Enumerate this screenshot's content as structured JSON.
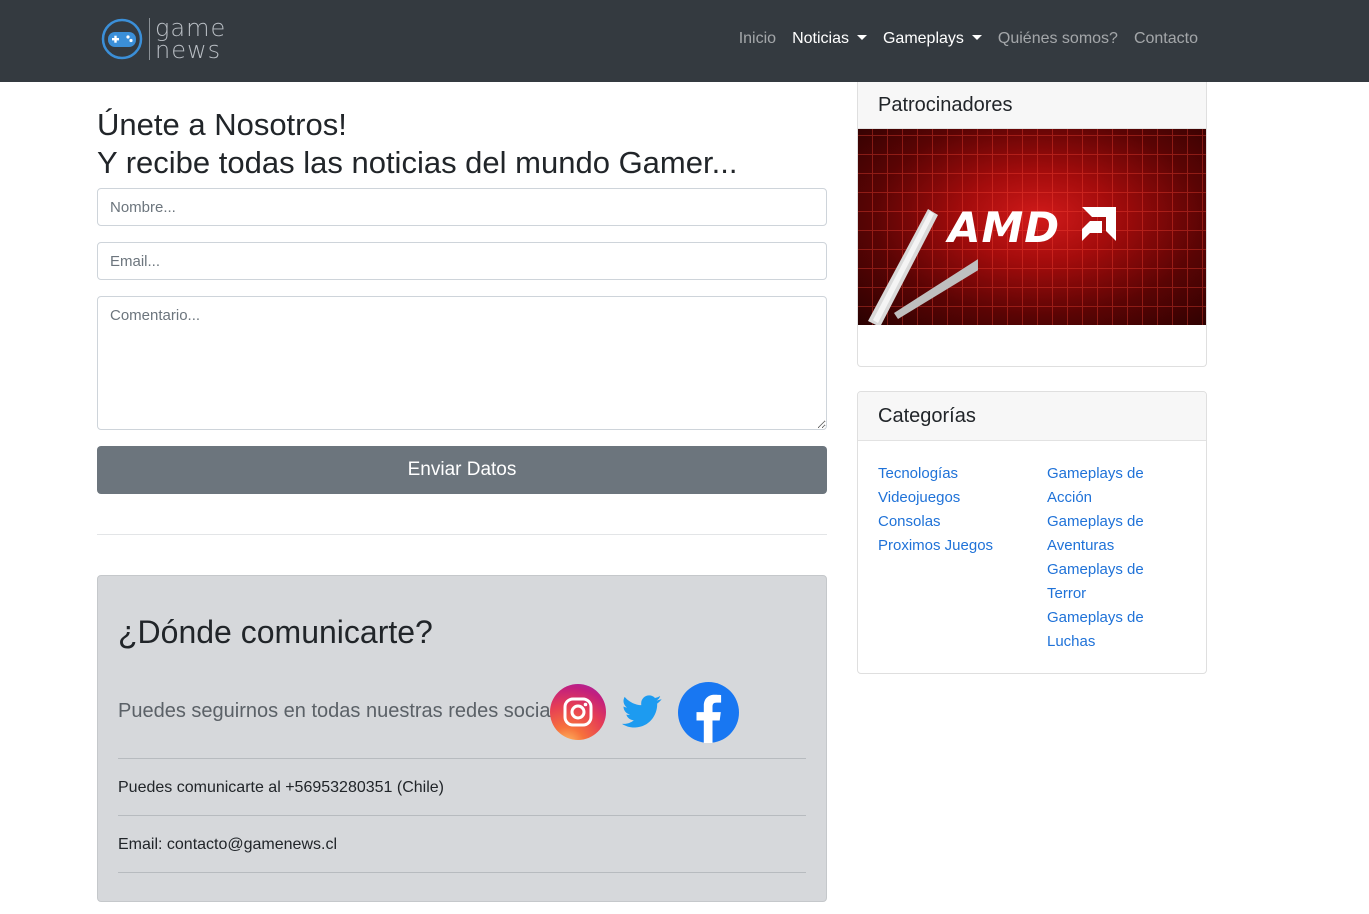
{
  "brand": {
    "line1": "game",
    "line2": "news",
    "icon": "gamepad-icon"
  },
  "nav": {
    "items": [
      {
        "label": "Inicio",
        "active": false,
        "dropdown": false
      },
      {
        "label": "Noticias",
        "active": true,
        "dropdown": true
      },
      {
        "label": "Gameplays",
        "active": true,
        "dropdown": true
      },
      {
        "label": "Quiénes somos?",
        "active": false,
        "dropdown": false
      },
      {
        "label": "Contacto",
        "active": false,
        "dropdown": false
      }
    ]
  },
  "join": {
    "title_line1": "Únete a Nosotros!",
    "title_line2": "Y recibe todas las noticias del mundo Gamer...",
    "name_placeholder": "Nombre...",
    "email_placeholder": "Email...",
    "comment_placeholder": "Comentario...",
    "submit_label": "Enviar Datos"
  },
  "contact": {
    "title": "¿Dónde comunicarte?",
    "social_text": "Puedes seguirnos en todas nuestras redes sociales.",
    "social_icons": [
      "instagram-icon",
      "twitter-icon",
      "facebook-icon"
    ],
    "phone_text": "Puedes comunicarte al +56953280351 (Chile)",
    "email_text": "Email: contacto@gamenews.cl"
  },
  "sidebar": {
    "sponsors_title": "Patrocinadores",
    "sponsor_logo_text": "AMD",
    "categories_title": "Categorías",
    "categories_col1": [
      "Tecnologías",
      "Videojuegos",
      "Consolas",
      "Proximos Juegos"
    ],
    "categories_col2": [
      "Gameplays de",
      "Acción",
      "Gameplays de",
      "Aventuras",
      "Gameplays de",
      "Terror",
      "Gameplays de",
      "Luchas"
    ]
  },
  "colors": {
    "navbar": "#343a40",
    "button": "#6c757d",
    "link": "#1f72d8",
    "contact_bg": "#d6d8db"
  }
}
